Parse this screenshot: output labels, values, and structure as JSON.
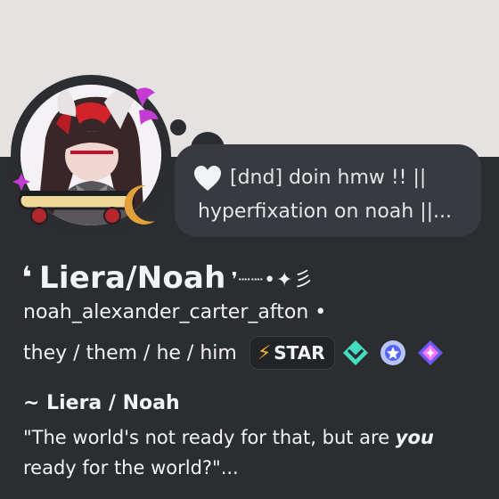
{
  "profile": {
    "status": {
      "line1": "[dnd] doin hmw !! ||",
      "line2": "hyperfixation on noah ||..."
    },
    "display_name": {
      "open_quote": "❛",
      "name": "Liera/Noah",
      "deco": "❜┈┈•✦彡"
    },
    "username": "noah_alexander_carter_afton  •",
    "pronouns": "they / them / he / him",
    "server_tag": {
      "icon": "lightning-icon",
      "label": "STAR"
    },
    "badges": [
      "hypesquad-balance-icon",
      "quest-laurel-icon",
      "nitro-gem-icon"
    ],
    "bio": {
      "name": "~ Liera / Noah",
      "quote_part1": "\"The world's not ready for that, but are ",
      "quote_emph": "you",
      "quote_part2": " ready for the world?\"..."
    },
    "colors": {
      "background": "#2b2d31",
      "banner": "#e6e2e2",
      "bubble": "#383a40",
      "accent_pink": "#c43bd1",
      "tag_bolt": "#f0b232"
    }
  }
}
